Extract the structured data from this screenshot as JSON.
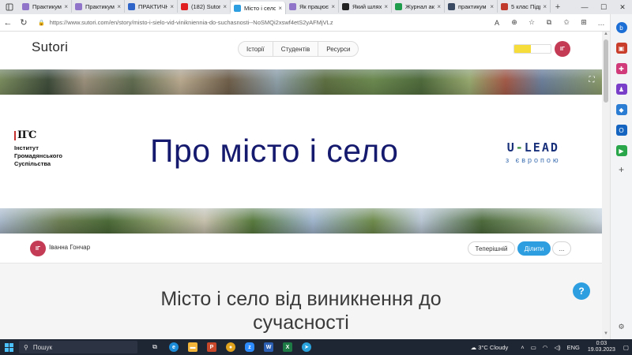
{
  "browser": {
    "tabs": [
      {
        "label": "Практикум",
        "color": "#8f74c9",
        "active": false
      },
      {
        "label": "Практикум",
        "color": "#8f74c9",
        "active": false
      },
      {
        "label": "ПРАКТИЧН",
        "color": "#2f64c8",
        "active": false
      },
      {
        "label": "(182) Sutori",
        "color": "#e02020",
        "active": false
      },
      {
        "label": "Місто і село",
        "color": "#2d9ee0",
        "active": true
      },
      {
        "label": "Як працює",
        "color": "#8f74c9",
        "active": false
      },
      {
        "label": "Який шлях",
        "color": "#222222",
        "active": false
      },
      {
        "label": "Журнал ак",
        "color": "#1e9c4b",
        "active": false
      },
      {
        "label": "практикум",
        "color": "#3b4a63",
        "active": false
      },
      {
        "label": "5 клас Підр",
        "color": "#c0392b",
        "active": false
      }
    ],
    "new_tab_symbol": "+",
    "url": "https://www.sutori.com/en/story/misto-i-sielo-vid-vinikniennia-do-suchasnosti--NoSMQi2xswf4etS2yAFMjVLz"
  },
  "site": {
    "logo": "Sutori",
    "nav": [
      "Історії",
      "Студентів",
      "Ресурси"
    ],
    "user_initials": "ІГ",
    "upgrade_meter_fraction": 0.45
  },
  "banner": {
    "isu_mark": "ІГС",
    "isu_lines": [
      "Інститут",
      "Громадянського",
      "Суспільства"
    ],
    "title": "Про місто і село",
    "ulead_main_left": "U",
    "ulead_dash": "-",
    "ulead_main_right": "LEAD",
    "ulead_sub": "з європою"
  },
  "author": {
    "initials": "ІГ",
    "name": "Іванна Гончар",
    "btn_current": "Теперішній",
    "btn_share": "Ділити",
    "btn_more": "..."
  },
  "story": {
    "title_line1": "Місто і село від виникнення до",
    "title_line2": "сучасності"
  },
  "help_label": "?",
  "taskbar": {
    "search_placeholder": "Пошук",
    "weather": "3°C  Cloudy",
    "lang": "ENG",
    "time": "0:03",
    "date": "19.03.2023"
  },
  "colors": {
    "accent_blue": "#2d9ee0",
    "avatar": "#c33b54",
    "banner_title": "#161a6e",
    "upgrade_yellow": "#f6dd3b"
  }
}
